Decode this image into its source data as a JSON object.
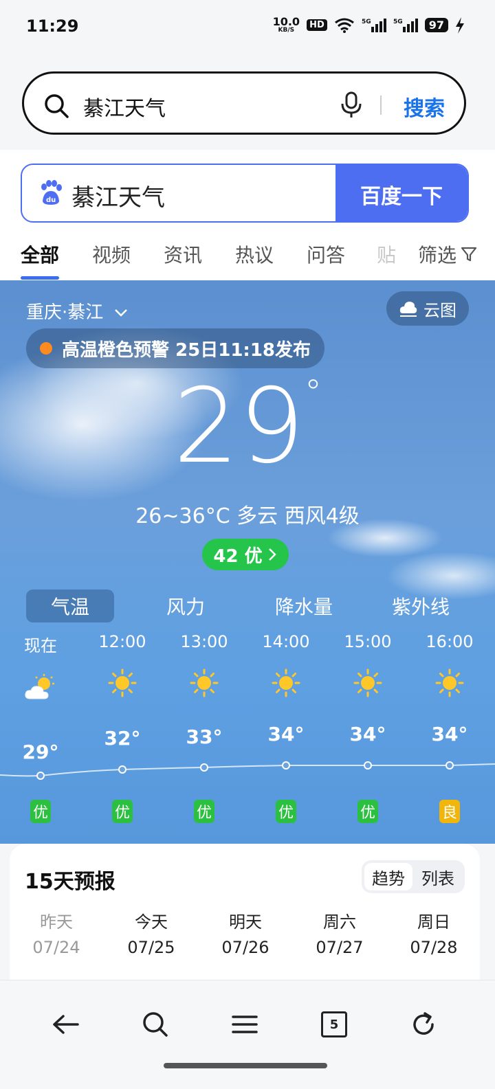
{
  "status": {
    "time": "11:29",
    "net_speed": "10.0",
    "net_unit": "KB/S",
    "hd": "HD",
    "battery": "97"
  },
  "top_search": {
    "query": "綦江天气",
    "go_label": "搜索"
  },
  "baidu": {
    "query": "綦江天气",
    "button_label": "百度一下"
  },
  "tabs": [
    {
      "label": "全部"
    },
    {
      "label": "视频"
    },
    {
      "label": "资讯"
    },
    {
      "label": "热议"
    },
    {
      "label": "问答"
    },
    {
      "label": "贴"
    }
  ],
  "filter_label": "筛选",
  "weather": {
    "location": "重庆·綦江",
    "cloud_map_label": "云图",
    "alert": "高温橙色预警 25日11:18发布",
    "current_temp": "29",
    "summary": "26~36°C 多云 西风4级",
    "aqi": "42 优"
  },
  "metric_tabs": [
    "气温",
    "风力",
    "降水量",
    "紫外线"
  ],
  "hourly": [
    {
      "time": "现在",
      "temp": "29°",
      "quality": "优",
      "icon": "partly-cloudy-icon"
    },
    {
      "time": "12:00",
      "temp": "32°",
      "quality": "优",
      "icon": "sun-icon"
    },
    {
      "time": "13:00",
      "temp": "33°",
      "quality": "优",
      "icon": "sun-icon"
    },
    {
      "time": "14:00",
      "temp": "34°",
      "quality": "优",
      "icon": "sun-icon"
    },
    {
      "time": "15:00",
      "temp": "34°",
      "quality": "优",
      "icon": "sun-icon"
    },
    {
      "time": "16:00",
      "temp": "34°",
      "quality": "良",
      "icon": "sun-icon"
    }
  ],
  "forecast": {
    "title": "15天预报",
    "toggle": [
      "趋势",
      "列表"
    ],
    "days": [
      {
        "name": "昨天",
        "date": "07/24"
      },
      {
        "name": "今天",
        "date": "07/25"
      },
      {
        "name": "明天",
        "date": "07/26"
      },
      {
        "name": "周六",
        "date": "07/27"
      },
      {
        "name": "周日",
        "date": "07/28"
      }
    ]
  },
  "bottom_nav": {
    "tab_count": "5"
  },
  "colors": {
    "accent": "#4e6ef2",
    "good": "#2cc041",
    "fair": "#f2b50a",
    "alert_dot": "#ff8a1f"
  }
}
